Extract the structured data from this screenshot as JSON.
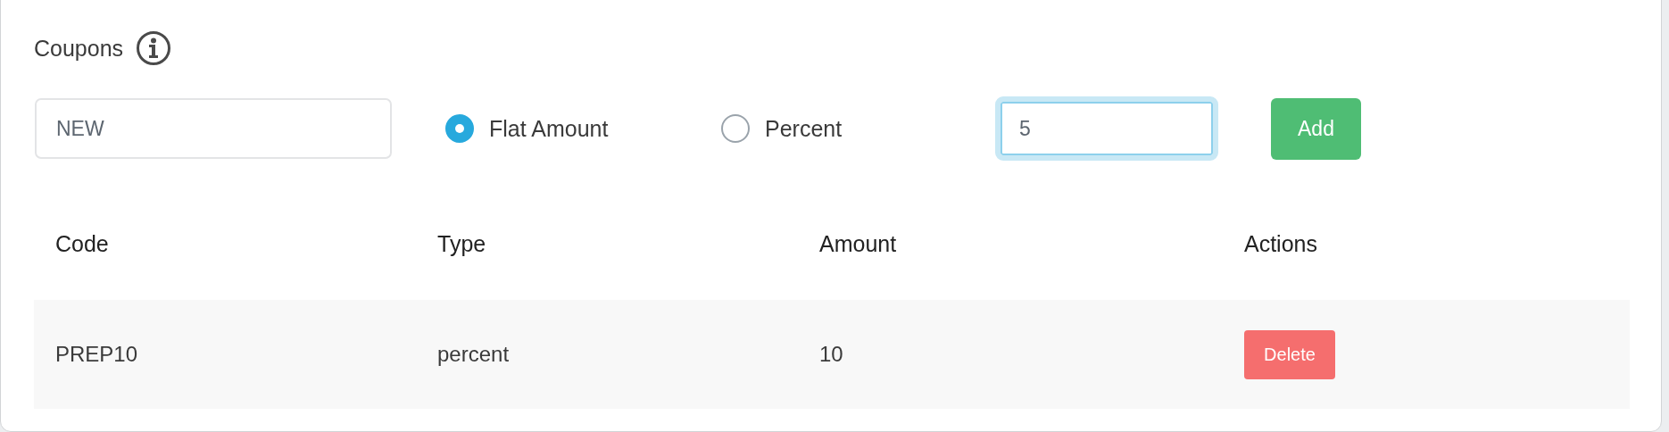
{
  "title": "Coupons",
  "form": {
    "code": {
      "value": "NEW"
    },
    "type_options": [
      {
        "label": "Flat Amount",
        "selected": true
      },
      {
        "label": "Percent",
        "selected": false
      }
    ],
    "amount": {
      "value": "5",
      "focused": true
    },
    "add_button": "Add"
  },
  "table": {
    "columns": [
      "Code",
      "Type",
      "Amount",
      "Actions"
    ],
    "rows": [
      {
        "code": "PREP10",
        "type": "percent",
        "amount": "10",
        "action": "Delete"
      }
    ]
  }
}
